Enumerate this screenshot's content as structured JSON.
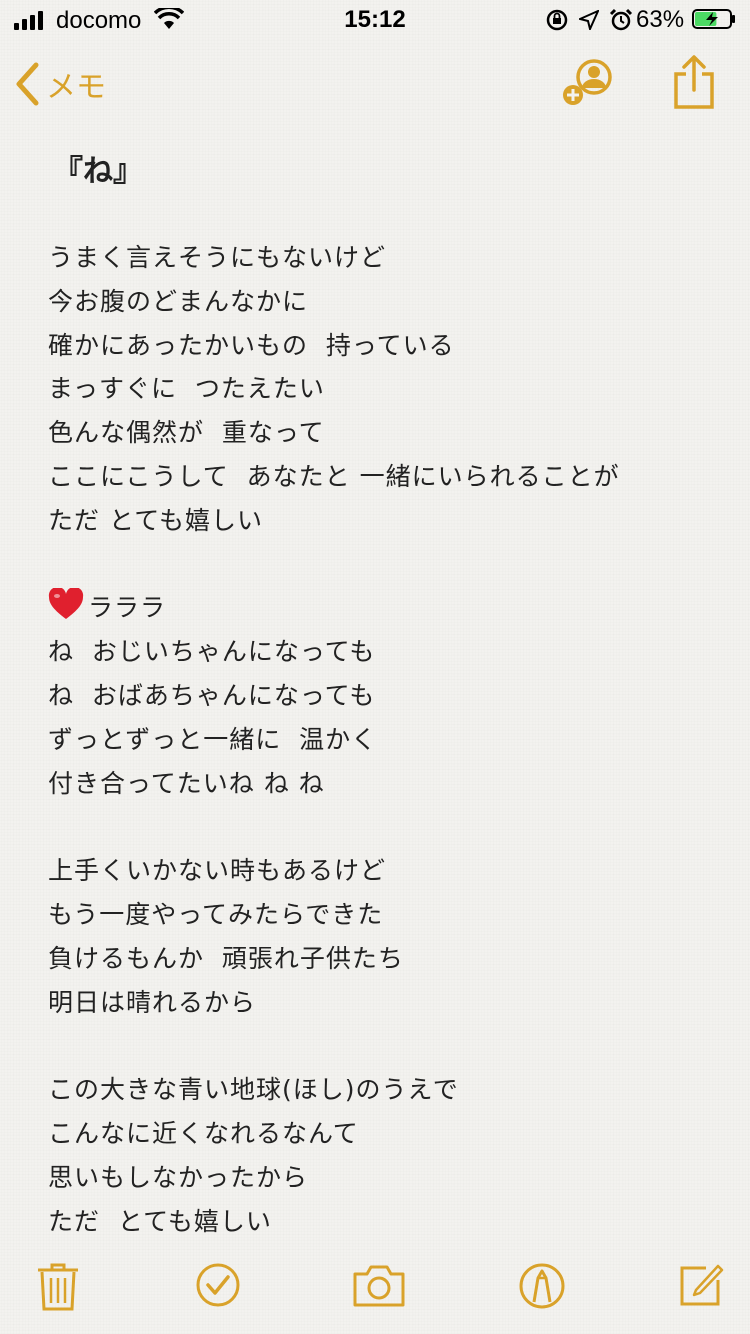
{
  "status": {
    "carrier": "docomo",
    "time": "15:12",
    "battery_percent": "63%",
    "battery_level": 0.63
  },
  "nav": {
    "back_label": "メモ",
    "back_icon": "chevron-left-icon",
    "add_person_icon": "add-person-icon",
    "share_icon": "share-icon"
  },
  "note": {
    "title": "『ね』",
    "lines": [
      "うまく言えそうにもないけど",
      "今お腹のどまんなかに",
      "確かにあったかいもの  持っている",
      "まっすぐに  つたえたい",
      "色んな偶然が  重なって",
      "ここにこうして  あなたと 一緒にいられることが",
      "ただ とても嬉しい",
      "",
      "ラララ",
      "ね  おじいちゃんになっても",
      "ね  おばあちゃんになっても",
      "ずっとずっと一緒に  温かく",
      "付き合ってたいね ね ね",
      "",
      "上手くいかない時もあるけど",
      "もう一度やってみたらできた",
      "負けるもんか  頑張れ子供たち",
      "明日は晴れるから",
      "",
      "この大きな青い地球(ほし)のうえで",
      "こんなに近くなれるなんて",
      "思いもしなかったから",
      "ただ  とても嬉しい"
    ]
  },
  "toolbar": {
    "icons": [
      "trash-icon",
      "checklist-icon",
      "camera-icon",
      "markup-icon",
      "compose-icon"
    ]
  },
  "colors": {
    "accent": "#d9a22a",
    "text": "#222222",
    "background": "#f3f2ef",
    "heart": "#e0202e"
  }
}
